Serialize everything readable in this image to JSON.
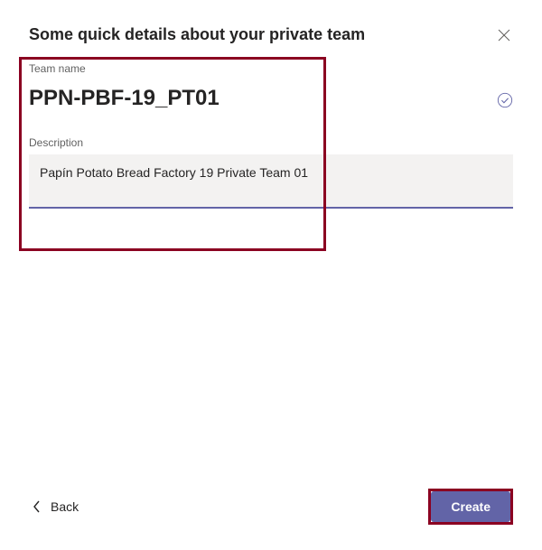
{
  "dialog": {
    "title": "Some quick details about your private team"
  },
  "form": {
    "name_label": "Team name",
    "name_value": "PPN-PBF-19_PT01",
    "desc_label": "Description",
    "desc_value": "Papín Potato Bread Factory 19 Private Team 01"
  },
  "footer": {
    "back_label": "Back",
    "create_label": "Create"
  },
  "icons": {
    "close": "close-icon",
    "check": "checkmark-circle-icon",
    "chevron_left": "chevron-left-icon"
  }
}
